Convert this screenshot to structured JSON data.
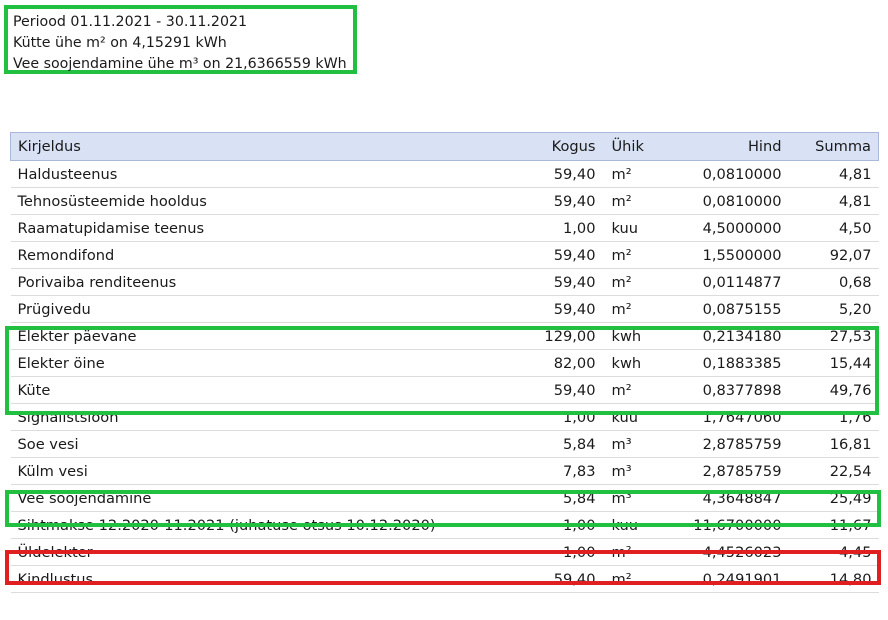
{
  "summary": {
    "period": "Periood 01.11.2021 - 30.11.2021",
    "heating": "Kütte ühe m² on 4,15291  kWh",
    "water_heating": "Vee soojendamine ühe m³ on 21,6366559 kWh"
  },
  "table": {
    "headers": {
      "description": "Kirjeldus",
      "quantity": "Kogus",
      "unit": "Ühik",
      "price": "Hind",
      "sum": "Summa"
    },
    "rows": [
      {
        "description": "Haldusteenus",
        "quantity": "59,40",
        "unit": "m²",
        "price": "0,0810000",
        "sum": "4,81"
      },
      {
        "description": "Tehnosüsteemide hooldus",
        "quantity": "59,40",
        "unit": "m²",
        "price": "0,0810000",
        "sum": "4,81"
      },
      {
        "description": "Raamatupidamise teenus",
        "quantity": "1,00",
        "unit": "kuu",
        "price": "4,5000000",
        "sum": "4,50"
      },
      {
        "description": "Remondifond",
        "quantity": "59,40",
        "unit": "m²",
        "price": "1,5500000",
        "sum": "92,07"
      },
      {
        "description": "Porivaiba renditeenus",
        "quantity": "59,40",
        "unit": "m²",
        "price": "0,0114877",
        "sum": "0,68"
      },
      {
        "description": "Prügivedu",
        "quantity": "59,40",
        "unit": "m²",
        "price": "0,0875155",
        "sum": "5,20"
      },
      {
        "description": "Elekter päevane",
        "quantity": "129,00",
        "unit": "kwh",
        "price": "0,2134180",
        "sum": "27,53"
      },
      {
        "description": "Elekter öine",
        "quantity": "82,00",
        "unit": "kwh",
        "price": "0,1883385",
        "sum": "15,44"
      },
      {
        "description": "Küte",
        "quantity": "59,40",
        "unit": "m²",
        "price": "0,8377898",
        "sum": "49,76"
      },
      {
        "description": "Signalistsioon",
        "quantity": "1,00",
        "unit": "kuu",
        "price": "1,7647060",
        "sum": "1,76"
      },
      {
        "description": "Soe vesi",
        "quantity": "5,84",
        "unit": "m³",
        "price": "2,8785759",
        "sum": "16,81"
      },
      {
        "description": "Külm vesi",
        "quantity": "7,83",
        "unit": "m³",
        "price": "2,8785759",
        "sum": "22,54"
      },
      {
        "description": "Vee soojendamine",
        "quantity": "5,84",
        "unit": "m³",
        "price": "4,3648847",
        "sum": "25,49"
      },
      {
        "description": "Sihtmakse 12.2020-11.2021 (juhatuse otsus 10.12.2020)",
        "quantity": "1,00",
        "unit": "kuu",
        "price": "11,6700000",
        "sum": "11,67"
      },
      {
        "description": "Üldelekter",
        "quantity": "1,00",
        "unit": "m²",
        "price": "4,4526023",
        "sum": "4,45"
      },
      {
        "description": "Kindlustus",
        "quantity": "59,40",
        "unit": "m²",
        "price": "0,2491901",
        "sum": "14,80"
      }
    ]
  },
  "colors": {
    "highlight_green": "#22c040",
    "highlight_red": "#e02020",
    "header_bg": "#d9e2f5"
  }
}
